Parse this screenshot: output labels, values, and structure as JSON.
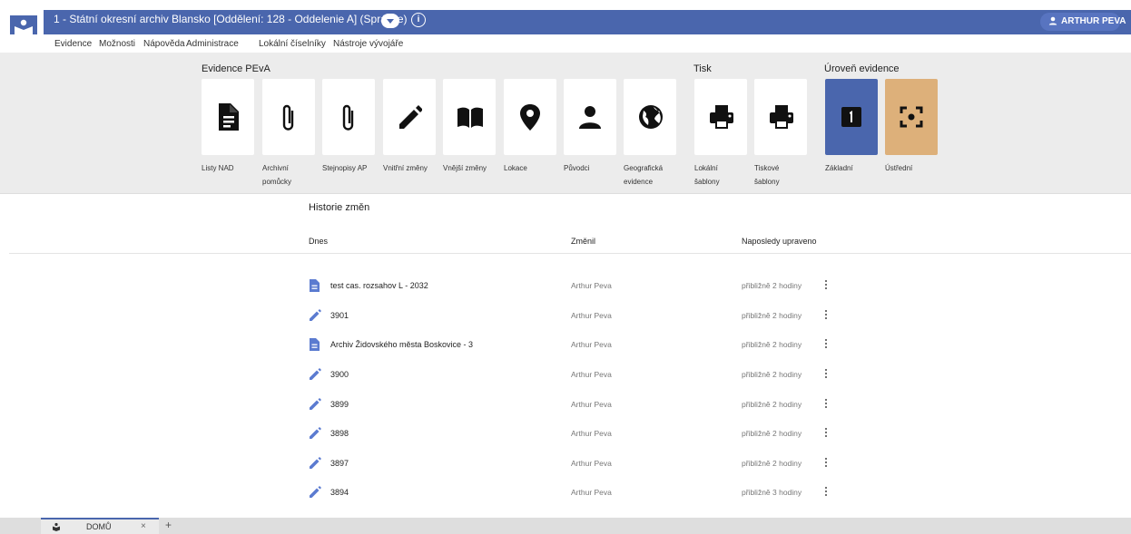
{
  "header": {
    "context_title": "1 - Státní okresní archiv Blansko [Oddělení: 128 - Oddelenie A] (Správce)",
    "user_name": "ARTHUR PEVA"
  },
  "menu": [
    "Evidence",
    "Možnosti",
    "Nápověda",
    "Administrace",
    "Lokální číselníky",
    "Nástroje vývojáře"
  ],
  "ribbon": {
    "groups": {
      "evidence": "Evidence PEvA",
      "tisk": "Tisk",
      "uroven": "Úroveň evidence"
    },
    "tiles": [
      {
        "label": "Listy NAD",
        "icon": "document-icon"
      },
      {
        "label": "Archivní pomůcky",
        "icon": "paperclip-icon"
      },
      {
        "label": "Stejnopisy AP",
        "icon": "paperclip-icon"
      },
      {
        "label": "Vnitřní změny",
        "icon": "pencil-icon"
      },
      {
        "label": "Vnější změny",
        "icon": "book-icon"
      },
      {
        "label": "Lokace",
        "icon": "location-pin-icon"
      },
      {
        "label": "Původci",
        "icon": "person-icon"
      },
      {
        "label": "Geografická evidence",
        "icon": "globe-icon"
      },
      {
        "label": "Lokální šablony",
        "icon": "printer-icon"
      },
      {
        "label": "Tiskové šablony",
        "icon": "printer-icon"
      },
      {
        "label": "Základní",
        "icon": "level-one-icon",
        "color": "#4a66ad"
      },
      {
        "label": "Ústřední",
        "icon": "center-focus-icon",
        "color": "#ddb07a"
      }
    ]
  },
  "history": {
    "title": "Historie změn",
    "columns": {
      "today": "Dnes",
      "changed_by": "Změnil",
      "last_modified": "Naposledy upraveno"
    },
    "rows": [
      {
        "type": "document",
        "name": "test cas. rozsahov L - 2032",
        "user": "Arthur Peva",
        "time": "přibližně 2 hodiny"
      },
      {
        "type": "edit",
        "name": "3901",
        "user": "Arthur Peva",
        "time": "přibližně 2 hodiny"
      },
      {
        "type": "document",
        "name": "Archiv Židovského města Boskovice - 3",
        "user": "Arthur Peva",
        "time": "přibližně 2 hodiny"
      },
      {
        "type": "edit",
        "name": "3900",
        "user": "Arthur Peva",
        "time": "přibližně 2 hodiny"
      },
      {
        "type": "edit",
        "name": "3899",
        "user": "Arthur Peva",
        "time": "přibližně 2 hodiny"
      },
      {
        "type": "edit",
        "name": "3898",
        "user": "Arthur Peva",
        "time": "přibližně 2 hodiny"
      },
      {
        "type": "edit",
        "name": "3897",
        "user": "Arthur Peva",
        "time": "přibližně 2 hodiny"
      },
      {
        "type": "edit",
        "name": "3894",
        "user": "Arthur Peva",
        "time": "přibližně 3 hodiny"
      }
    ]
  },
  "tabs": [
    {
      "label": "DOMŮ",
      "close": "×"
    }
  ],
  "add_tab": "+",
  "colors": {
    "primary": "#4a66ad",
    "tan": "#ddb07a",
    "ribbon_bg": "#ececec"
  }
}
